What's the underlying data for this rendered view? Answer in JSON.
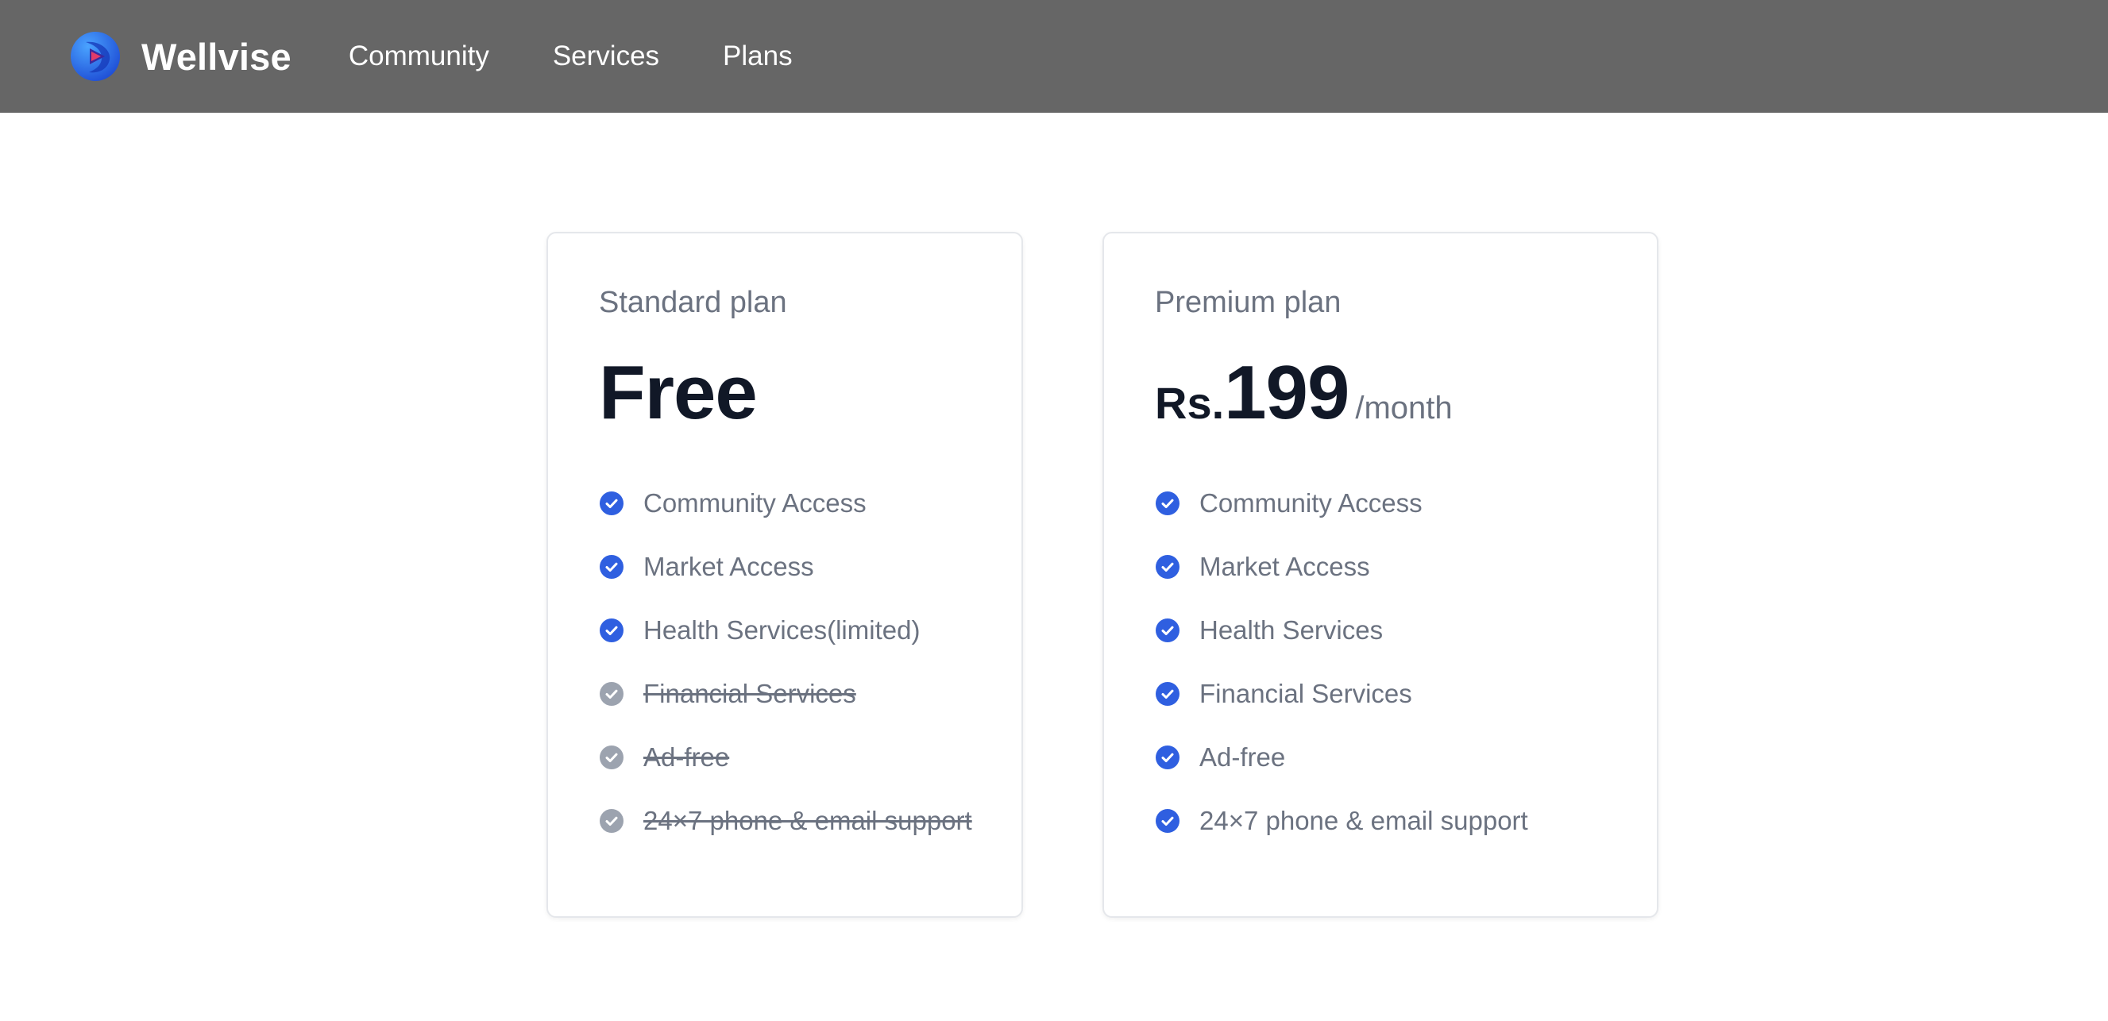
{
  "navbar": {
    "brand": "Wellvise",
    "links": [
      "Community",
      "Services",
      "Plans"
    ]
  },
  "colors": {
    "navbar_bg": "#666666",
    "check_enabled": "#2f5fe0",
    "check_disabled": "#9ca3af",
    "heading": "#111827",
    "muted_text": "#6b7280"
  },
  "plans": {
    "standard": {
      "name": "Standard plan",
      "price": "Free",
      "features": [
        {
          "label": "Community Access",
          "included": true
        },
        {
          "label": "Market Access",
          "included": true
        },
        {
          "label": "Health Services(limited)",
          "included": true
        },
        {
          "label": "Financial Services",
          "included": false
        },
        {
          "label": "Ad-free",
          "included": false
        },
        {
          "label": "24×7 phone & email support",
          "included": false
        }
      ]
    },
    "premium": {
      "name": "Premium plan",
      "currency": "Rs.",
      "amount": "199",
      "period": "/month",
      "features": [
        {
          "label": "Community Access",
          "included": true
        },
        {
          "label": "Market Access",
          "included": true
        },
        {
          "label": "Health Services",
          "included": true
        },
        {
          "label": "Financial Services",
          "included": true
        },
        {
          "label": "Ad-free",
          "included": true
        },
        {
          "label": "24×7 phone & email support",
          "included": true
        }
      ]
    }
  }
}
